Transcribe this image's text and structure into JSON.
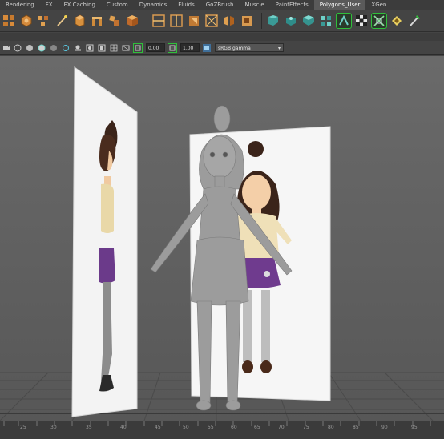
{
  "shelf_tabs": [
    "Rendering",
    "FX",
    "FX Caching",
    "Custom",
    "Dynamics",
    "Fluids",
    "GoZBrush",
    "Muscle",
    "PaintEffects",
    "Polygons_User",
    "XGen"
  ],
  "panel_toolbar": {
    "exposure_value": "0.00",
    "gamma_value": "1.00",
    "color_space": "sRGB gamma"
  },
  "timeline": {
    "tick_labels": [
      "25",
      "30",
      "35",
      "40",
      "45",
      "50",
      "55",
      "60",
      "65",
      "70",
      "75",
      "80",
      "85",
      "90",
      "95"
    ]
  },
  "colors": {
    "accent_highlight": "#2fbf3a",
    "viewport_bg": "#666666",
    "tab_bar": "#3c3c3c"
  }
}
